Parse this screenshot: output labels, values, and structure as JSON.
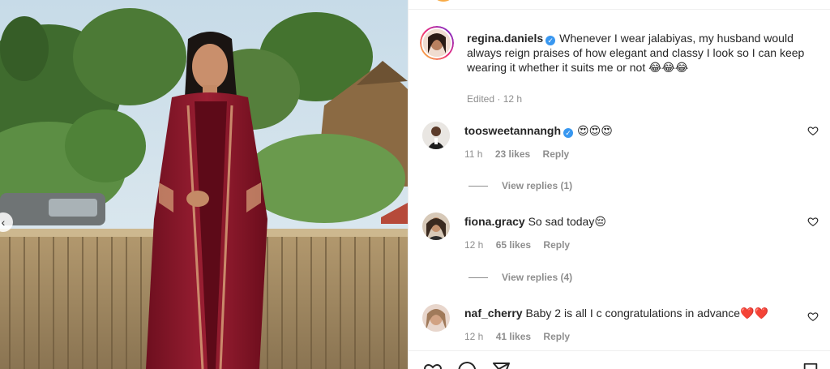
{
  "post": {
    "username": "regina.daniels",
    "caption": "Whenever I wear jalabiyas, my husband would always reign praises of how elegant and classy I look so I can keep wearing it whether it suits me or not 😂😂😂",
    "edited_label": "Edited",
    "time": "12 h"
  },
  "comments": [
    {
      "username": "toosweetannangh",
      "verified": true,
      "text": "😍😍😍",
      "time": "11 h",
      "likes": "23 likes",
      "reply": "Reply",
      "view_replies": "View replies (1)"
    },
    {
      "username": "fiona.gracy",
      "verified": false,
      "text": "So sad today😔",
      "time": "12 h",
      "likes": "65 likes",
      "reply": "Reply",
      "view_replies": "View replies (4)"
    },
    {
      "username": "naf_cherry",
      "verified": false,
      "text": "Baby 2 is all I c congratulations in advance❤️❤️",
      "time": "12 h",
      "likes": "41 likes",
      "reply": "Reply"
    }
  ],
  "icons": {
    "verified": "verified-badge-icon",
    "like": "heart-icon",
    "comment": "comment-icon",
    "share": "share-icon",
    "save": "bookmark-icon",
    "prev": "chevron-left-icon"
  },
  "colors": {
    "verified_blue": "#3897f0",
    "muted_text": "#8e8e8e",
    "primary_text": "#262626"
  }
}
